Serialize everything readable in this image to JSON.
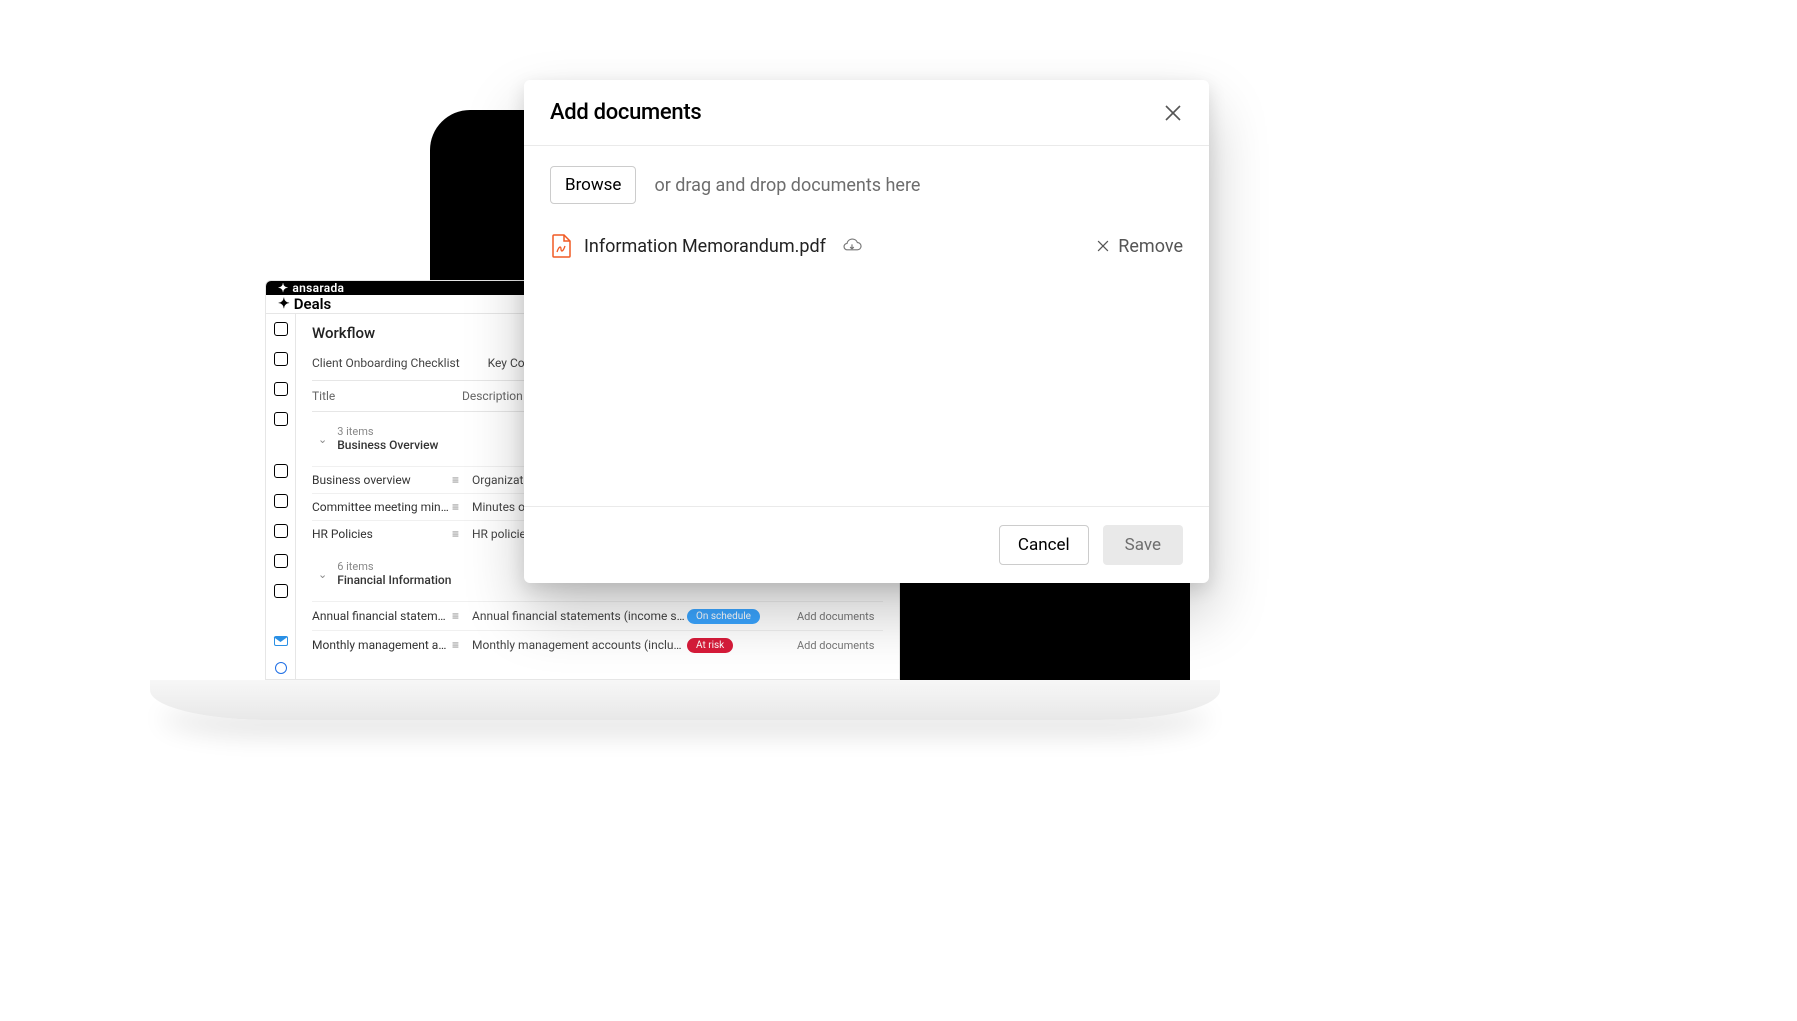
{
  "brand": "ansarada",
  "app_name": "Deals",
  "page_title": "Workflow",
  "tabs": [
    "Client Onboarding Checklist",
    "Key Contacts"
  ],
  "columns": {
    "title": "Title",
    "description": "Description"
  },
  "sections": [
    {
      "count_label": "3 items",
      "name": "Business Overview",
      "rows": [
        {
          "title": "Business overview",
          "description": "Organization c"
        },
        {
          "title": "Committee meeting minutes",
          "description": "Minutes of sha"
        },
        {
          "title": "HR Policies",
          "description": "HR policies anc"
        }
      ]
    },
    {
      "count_label": "6 items",
      "name": "Financial Information",
      "rows": [
        {
          "title": "Annual financial statements",
          "description": "Annual financial statements (income statement, ba…",
          "status": "On schedule",
          "status_color": "blue",
          "action": "Add documents"
        },
        {
          "title": "Monthly management acco…",
          "description": "Monthly management accounts (including key fina…",
          "status": "At risk",
          "status_color": "red",
          "action": "Add documents"
        }
      ]
    }
  ],
  "modal": {
    "title": "Add documents",
    "browse_label": "Browse",
    "hint": "or drag and drop documents here",
    "file_name": "Information Memorandum.pdf",
    "remove_label": "Remove",
    "cancel_label": "Cancel",
    "save_label": "Save"
  }
}
